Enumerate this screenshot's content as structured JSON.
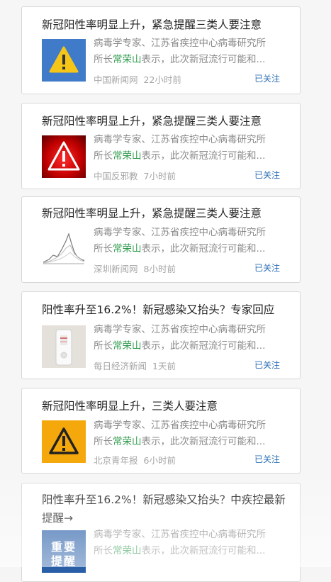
{
  "articles": [
    {
      "title": "新冠阳性率明显上升，紧急提醒三类人要注意",
      "summary_line1": "病毒学专家、江苏省疾控中心病毒研究所",
      "summary_pre": "所长",
      "summary_highlight": "常荣山",
      "summary_post": "表示，此次新冠流行可能和...",
      "source": "中国新闻网",
      "time": "22小时前",
      "follow_label": "已关注",
      "thumb_icon": "warning-triangle-icon"
    },
    {
      "title": "新冠阳性率明显上升，紧急提醒三类人要注意",
      "summary_line1": "病毒学专家、江苏省疾控中心病毒研究所",
      "summary_pre": "所长",
      "summary_highlight": "常荣山",
      "summary_post": "表示，此次新冠流行可能和...",
      "source": "中国反邪教",
      "time": "7小时前",
      "follow_label": "已关注",
      "thumb_icon": "red-alert-icon"
    },
    {
      "title": "新冠阳性率明显上升，紧急提醒三类人要注意",
      "summary_line1": "病毒学专家、江苏省疾控中心病毒研究所",
      "summary_pre": "所长",
      "summary_highlight": "常荣山",
      "summary_post": "表示，此次新冠流行可能和...",
      "source": "深圳新闻网",
      "time": "8小时前",
      "follow_label": "已关注",
      "thumb_icon": "line-chart-icon"
    },
    {
      "title": "阳性率升至16.2%！新冠感染又抬头？专家回应",
      "summary_line1": "病毒学专家、江苏省疾控中心病毒研究所",
      "summary_pre": "所长",
      "summary_highlight": "常荣山",
      "summary_post": "表示，此次新冠流行可能和...",
      "source": "每日经济新闻",
      "time": "1天前",
      "follow_label": "已关注",
      "thumb_icon": "test-kit-icon"
    },
    {
      "title": "新冠阳性率明显上升，三类人要注意",
      "summary_line1": "病毒学专家、江苏省疾控中心病毒研究所",
      "summary_pre": "所长",
      "summary_highlight": "常荣山",
      "summary_post": "表示，此次新冠流行可能和...",
      "source": "北京青年报",
      "time": "6小时前",
      "follow_label": "已关注",
      "thumb_icon": "warning-triangle-icon"
    },
    {
      "title": "阳性率升至16.2%！新冠感染又抬头？中疾控最新提醒→",
      "summary_line1": "病毒学专家、江苏省疾控中心病毒研究所",
      "summary_pre": "所长",
      "summary_highlight": "常荣山",
      "summary_post": "表示，此次新冠流行可能和...",
      "thumb_text": "重要提醒",
      "thumb_icon": "important-notice-icon"
    }
  ]
}
